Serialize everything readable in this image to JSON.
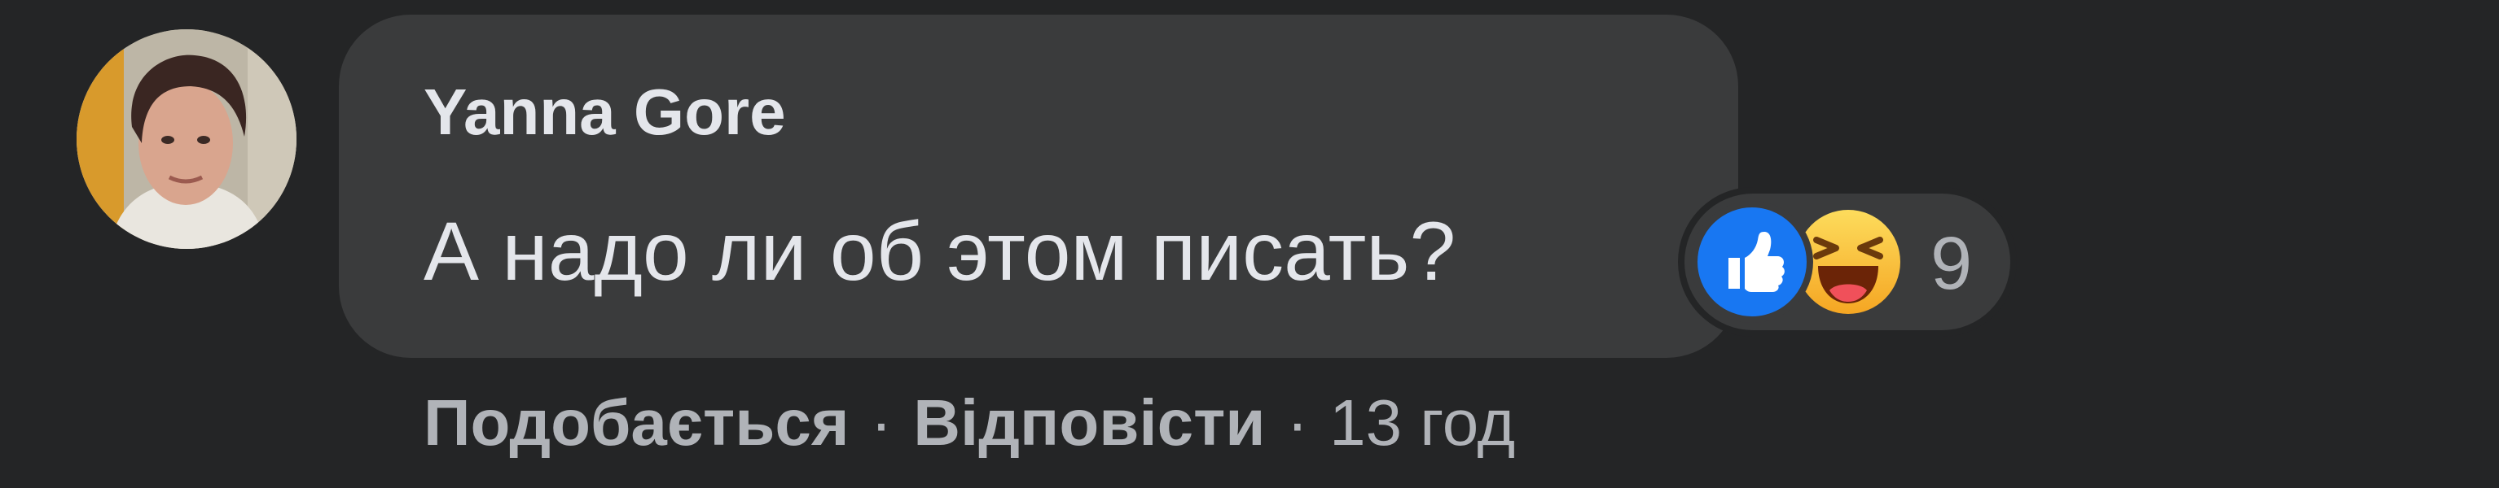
{
  "comment": {
    "author": "Yanna Gore",
    "text": "А надо ли об этом писать?",
    "reactions": {
      "icons": [
        "like-icon",
        "haha-icon"
      ],
      "count": "9"
    },
    "actions": {
      "like_label": "Подобається",
      "separator": "·",
      "reply_label": "Відповісти",
      "timestamp": "13 год"
    }
  },
  "colors": {
    "background": "#242526",
    "bubble": "#3a3b3c",
    "primary_text": "#e4e6eb",
    "secondary_text": "#b0b3b8",
    "like_blue": "#1877f2",
    "haha_yellow": "#f7b125"
  }
}
